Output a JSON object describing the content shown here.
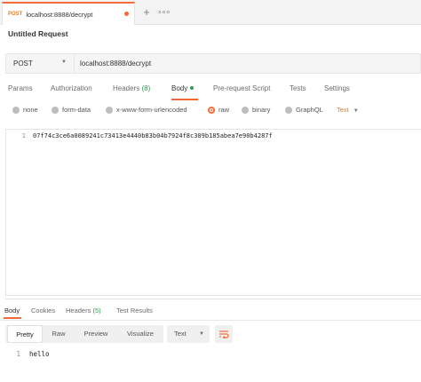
{
  "tab": {
    "method": "POST",
    "title": "localhost:8888/decrypt",
    "add_label": "+",
    "more_label": "∘∘∘"
  },
  "request": {
    "title": "Untitled Request",
    "method": "POST",
    "url": "localhost:8888/decrypt"
  },
  "request_tabs": [
    {
      "label": "Params"
    },
    {
      "label": "Authorization"
    },
    {
      "label": "Headers",
      "count": "(8)"
    },
    {
      "label": "Body"
    },
    {
      "label": "Pre-request Script"
    },
    {
      "label": "Tests"
    },
    {
      "label": "Settings"
    }
  ],
  "body_types": [
    {
      "label": "none"
    },
    {
      "label": "form-data"
    },
    {
      "label": "x-www-form-urlencoded"
    },
    {
      "label": "raw"
    },
    {
      "label": "binary"
    },
    {
      "label": "GraphQL"
    }
  ],
  "body_format": "Text",
  "editor": {
    "line_number": "1",
    "content": "07f74c3ce6a0089241c73413e4440b83b04b7924f8c309b185abea7e90b4287f"
  },
  "response_tabs": [
    {
      "label": "Body"
    },
    {
      "label": "Cookies"
    },
    {
      "label": "Headers",
      "count": "(5)"
    },
    {
      "label": "Test Results"
    }
  ],
  "response_view": {
    "modes": [
      "Pretty",
      "Raw",
      "Preview",
      "Visualize"
    ],
    "format": "Text"
  },
  "response_body": {
    "line_number": "1",
    "content": "hello"
  },
  "colors": {
    "accent": "#f26b3a",
    "method_post": "#e67e22",
    "success": "#2e9c4f"
  },
  "icons": {
    "body_dot": "green-dot-icon",
    "wrap": "wrap-lines-icon"
  }
}
